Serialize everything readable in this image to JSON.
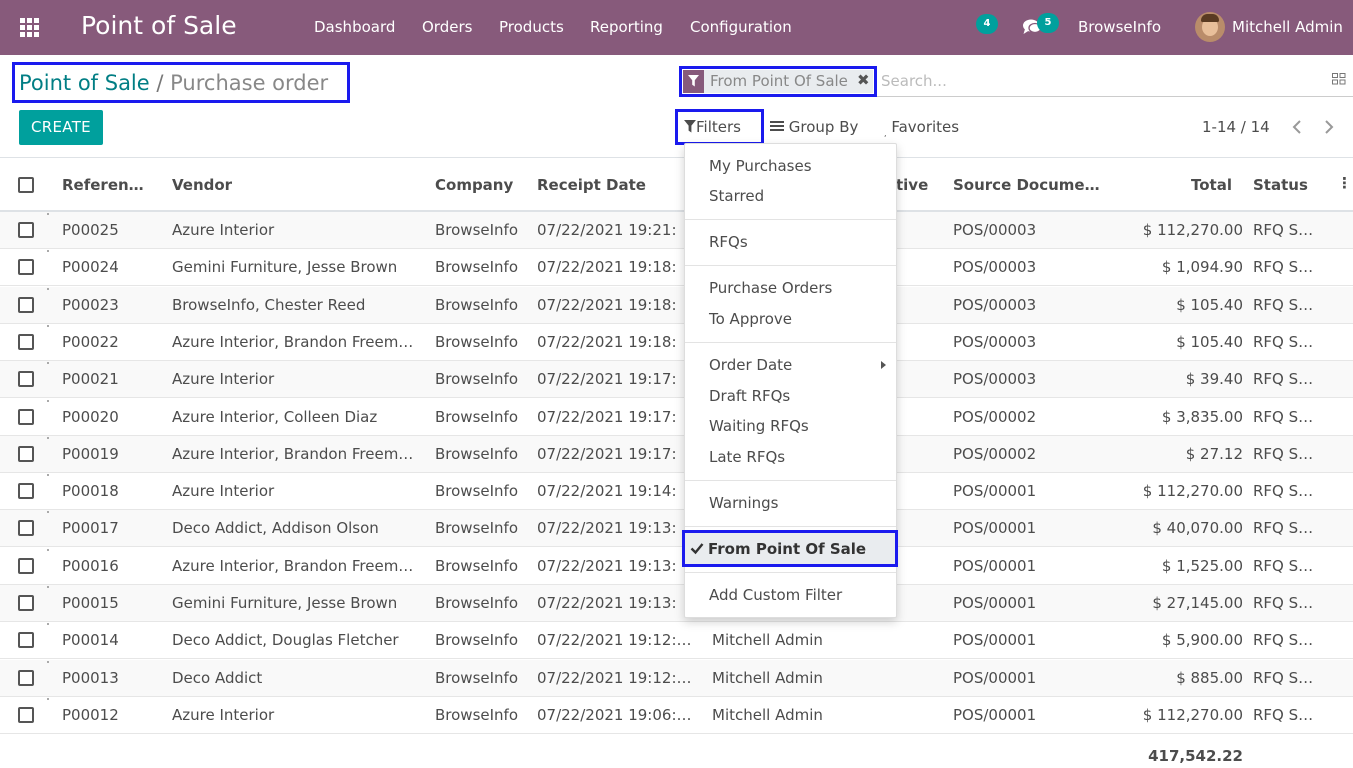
{
  "navbar": {
    "app_title": "Point of Sale",
    "menu": [
      "Dashboard",
      "Orders",
      "Products",
      "Reporting",
      "Configuration"
    ],
    "activity_count": "4",
    "message_count": "5",
    "company": "BrowseInfo",
    "user": "Mitchell Admin"
  },
  "breadcrumb": {
    "parent": "Point of Sale",
    "separator": "/",
    "current": "Purchase order"
  },
  "create_label": "CREATE",
  "search": {
    "facet_value": "From Point Of Sale",
    "placeholder": "Search..."
  },
  "controls": {
    "filters": "Filters",
    "group_by": "Group By",
    "favorites": "Favorites",
    "pager": "1-14 / 14"
  },
  "table": {
    "headers": [
      "Referen…",
      "Vendor",
      "Company",
      "Receipt Date",
      "tive",
      "Source Docume…",
      "Total",
      "Status"
    ],
    "rows": [
      {
        "ref": "P00025",
        "vendor": "Azure Interior",
        "company": "BrowseInfo",
        "date": "07/22/2021 19:21:",
        "rep": "",
        "source": "POS/00003",
        "total": "$ 112,270.00",
        "status": "RFQ S…"
      },
      {
        "ref": "P00024",
        "vendor": "Gemini Furniture, Jesse Brown",
        "company": "BrowseInfo",
        "date": "07/22/2021 19:18:",
        "rep": "",
        "source": "POS/00003",
        "total": "$ 1,094.90",
        "status": "RFQ S…"
      },
      {
        "ref": "P00023",
        "vendor": "BrowseInfo, Chester Reed",
        "company": "BrowseInfo",
        "date": "07/22/2021 19:18:",
        "rep": "",
        "source": "POS/00003",
        "total": "$ 105.40",
        "status": "RFQ S…"
      },
      {
        "ref": "P00022",
        "vendor": "Azure Interior, Brandon Freem…",
        "company": "BrowseInfo",
        "date": "07/22/2021 19:18:",
        "rep": "",
        "source": "POS/00003",
        "total": "$ 105.40",
        "status": "RFQ S…"
      },
      {
        "ref": "P00021",
        "vendor": "Azure Interior",
        "company": "BrowseInfo",
        "date": "07/22/2021 19:17:",
        "rep": "",
        "source": "POS/00003",
        "total": "$ 39.40",
        "status": "RFQ S…"
      },
      {
        "ref": "P00020",
        "vendor": "Azure Interior, Colleen Diaz",
        "company": "BrowseInfo",
        "date": "07/22/2021 19:17:",
        "rep": "",
        "source": "POS/00002",
        "total": "$ 3,835.00",
        "status": "RFQ S…"
      },
      {
        "ref": "P00019",
        "vendor": "Azure Interior, Brandon Freem…",
        "company": "BrowseInfo",
        "date": "07/22/2021 19:17:",
        "rep": "",
        "source": "POS/00002",
        "total": "$ 27.12",
        "status": "RFQ S…"
      },
      {
        "ref": "P00018",
        "vendor": "Azure Interior",
        "company": "BrowseInfo",
        "date": "07/22/2021 19:14:",
        "rep": "",
        "source": "POS/00001",
        "total": "$ 112,270.00",
        "status": "RFQ S…"
      },
      {
        "ref": "P00017",
        "vendor": "Deco Addict, Addison Olson",
        "company": "BrowseInfo",
        "date": "07/22/2021 19:13:",
        "rep": "",
        "source": "POS/00001",
        "total": "$ 40,070.00",
        "status": "RFQ S…"
      },
      {
        "ref": "P00016",
        "vendor": "Azure Interior, Brandon Freem…",
        "company": "BrowseInfo",
        "date": "07/22/2021 19:13:",
        "rep": "",
        "source": "POS/00001",
        "total": "$ 1,525.00",
        "status": "RFQ S…"
      },
      {
        "ref": "P00015",
        "vendor": "Gemini Furniture, Jesse Brown",
        "company": "BrowseInfo",
        "date": "07/22/2021 19:13:",
        "rep": "",
        "source": "POS/00001",
        "total": "$ 27,145.00",
        "status": "RFQ S…"
      },
      {
        "ref": "P00014",
        "vendor": "Deco Addict, Douglas Fletcher",
        "company": "BrowseInfo",
        "date": "07/22/2021 19:12:…",
        "rep": "Mitchell Admin",
        "source": "POS/00001",
        "total": "$ 5,900.00",
        "status": "RFQ S…"
      },
      {
        "ref": "P00013",
        "vendor": "Deco Addict",
        "company": "BrowseInfo",
        "date": "07/22/2021 19:12:…",
        "rep": "Mitchell Admin",
        "source": "POS/00001",
        "total": "$ 885.00",
        "status": "RFQ S…"
      },
      {
        "ref": "P00012",
        "vendor": "Azure Interior",
        "company": "BrowseInfo",
        "date": "07/22/2021 19:06:…",
        "rep": "Mitchell Admin",
        "source": "POS/00001",
        "total": "$ 112,270.00",
        "status": "RFQ S…"
      }
    ],
    "sum_total": "417,542.22"
  },
  "filters_menu": {
    "my_purchases": "My Purchases",
    "starred": "Starred",
    "rfqs": "RFQs",
    "purchase_orders": "Purchase Orders",
    "to_approve": "To Approve",
    "order_date": "Order Date",
    "draft_rfqs": "Draft RFQs",
    "waiting_rfqs": "Waiting RFQs",
    "late_rfqs": "Late RFQs",
    "warnings": "Warnings",
    "from_pos": "From Point Of Sale",
    "add_custom": "Add Custom Filter"
  },
  "colors": {
    "navbar": "#875a7b",
    "accent": "#00a09d",
    "link": "#017e84",
    "highlight_border": "#1a1aee"
  }
}
